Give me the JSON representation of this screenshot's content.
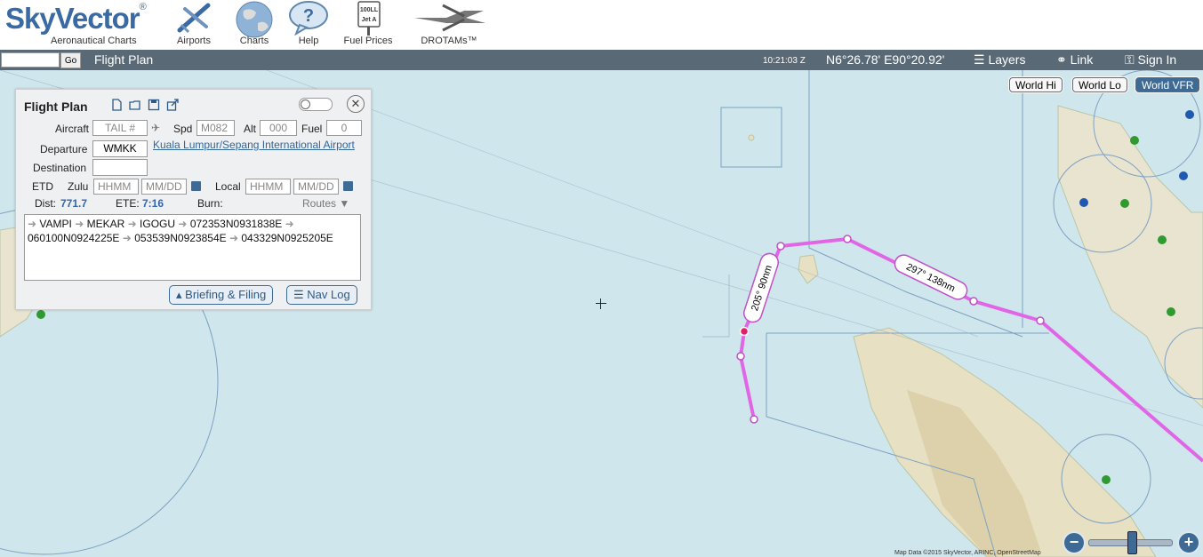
{
  "header": {
    "logo_text": "SkyVector",
    "logo_sub": "Aeronautical Charts",
    "nav": [
      {
        "label": "Airports",
        "icon": "airplane-icon"
      },
      {
        "label": "Charts",
        "icon": "globe-icon"
      },
      {
        "label": "Help",
        "icon": "help-bubble-icon"
      },
      {
        "label": "Fuel Prices",
        "icon": "fuel-sign-icon",
        "sign_text": [
          "100LL",
          "Jet A"
        ]
      },
      {
        "label": "DROTAMs™",
        "icon": "drone-icon"
      }
    ]
  },
  "toolbar": {
    "search_value": "",
    "go_label": "Go",
    "title": "Flight Plan",
    "clock": "10:21:03 Z",
    "coords": "N6°26.78' E90°20.92'",
    "layers_label": "Layers",
    "link_label": "Link",
    "signin_label": "Sign In"
  },
  "map": {
    "layer_buttons": [
      "World Hi",
      "World Lo",
      "World VFR"
    ],
    "active_layer": "World VFR",
    "route_color": "#e066e6",
    "leg_labels": [
      "205° 90nm",
      "297° 138nm"
    ],
    "attribution": "Map Data ©2015 SkyVector, ARINC, OpenStreetMap"
  },
  "flight_plan": {
    "title": "Flight Plan",
    "aircraft_label": "Aircraft",
    "aircraft_placeholder": "TAIL #",
    "spd_label": "Spd",
    "spd_placeholder": "M082",
    "alt_label": "Alt",
    "alt_placeholder": "000",
    "fuel_label": "Fuel",
    "fuel_placeholder": "0",
    "departure_label": "Departure",
    "departure_value": "WMKK",
    "departure_name": "Kuala Lumpur/Sepang International Airport",
    "destination_label": "Destination",
    "destination_value": "",
    "etd_label": "ETD",
    "zulu_label": "Zulu",
    "local_label": "Local",
    "time_placeholder": "HHMM",
    "date_placeholder": "MM/DD",
    "dist_label": "Dist:",
    "dist_value": "771.7",
    "ete_label": "ETE:",
    "ete_value": "7:16",
    "burn_label": "Burn:",
    "routes_label": "Routes",
    "route": [
      "VAMPI",
      "MEKAR",
      "IGOGU",
      "072353N0931838E",
      "060100N0924225E",
      "053539N0923854E",
      "043329N0925205E"
    ],
    "briefing_label": "Briefing & Filing",
    "navlog_label": "Nav Log"
  }
}
